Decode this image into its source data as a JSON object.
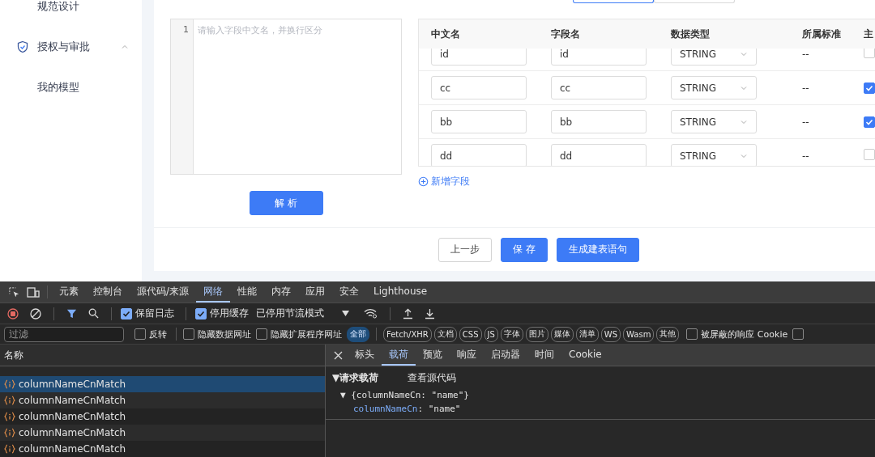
{
  "sidebar": {
    "items": [
      {
        "label": "规范设计",
        "kind": "sub"
      },
      {
        "label": "授权与审批",
        "kind": "group",
        "expanded": true
      },
      {
        "label": "我的模型",
        "kind": "sub"
      }
    ]
  },
  "segments": [
    {
      "selected": true
    },
    {
      "selected": false
    }
  ],
  "editor": {
    "line_number": "1",
    "placeholder": "请输入字段中文名，并换行区分"
  },
  "parse_button": "解 析",
  "table": {
    "columns": [
      "中文名",
      "字段名",
      "数据类型",
      "所属标准",
      "主"
    ],
    "rows": [
      {
        "name_cn": "id",
        "field": "id",
        "type": "STRING",
        "standard": "--",
        "primary": false
      },
      {
        "name_cn": "cc",
        "field": "cc",
        "type": "STRING",
        "standard": "--",
        "primary": true
      },
      {
        "name_cn": "bb",
        "field": "bb",
        "type": "STRING",
        "standard": "--",
        "primary": true
      },
      {
        "name_cn": "dd",
        "field": "dd",
        "type": "STRING",
        "standard": "--",
        "primary": false
      }
    ]
  },
  "add_field": "新增字段",
  "footer_buttons": [
    {
      "label": "上一步",
      "kind": "default"
    },
    {
      "label": "保 存",
      "kind": "primary"
    },
    {
      "label": "生成建表语句",
      "kind": "primary"
    }
  ],
  "devtools": {
    "tabs": [
      {
        "label": "元素",
        "selected": false
      },
      {
        "label": "控制台",
        "selected": false
      },
      {
        "label": "源代码/来源",
        "selected": false
      },
      {
        "label": "网络",
        "selected": true
      },
      {
        "label": "性能",
        "selected": false
      },
      {
        "label": "内存",
        "selected": false
      },
      {
        "label": "应用",
        "selected": false
      },
      {
        "label": "安全",
        "selected": false
      },
      {
        "label": "Lighthouse",
        "selected": false
      }
    ],
    "preserve_log": {
      "label": "保留日志",
      "checked": true
    },
    "disable_cache": {
      "label": "停用缓存",
      "checked": true
    },
    "throttling": "已停用节流模式",
    "filter": {
      "placeholder": "过滤"
    },
    "filter_checks": [
      {
        "label": "反转",
        "checked": false
      },
      {
        "label": "隐藏数据网址",
        "checked": false
      },
      {
        "label": "隐藏扩展程序网址",
        "checked": false
      }
    ],
    "chips": [
      {
        "label": "全部",
        "selected": true
      },
      {
        "label": "Fetch/XHR",
        "selected": false
      },
      {
        "label": "文档",
        "selected": false
      },
      {
        "label": "CSS",
        "selected": false
      },
      {
        "label": "JS",
        "selected": false
      },
      {
        "label": "字体",
        "selected": false
      },
      {
        "label": "图片",
        "selected": false
      },
      {
        "label": "媒体",
        "selected": false
      },
      {
        "label": "清单",
        "selected": false
      },
      {
        "label": "WS",
        "selected": false
      },
      {
        "label": "Wasm",
        "selected": false
      },
      {
        "label": "其他",
        "selected": false
      }
    ],
    "blocked_cookies": {
      "label": "被屏蔽的响应 Cookie",
      "checked": false
    },
    "edge_check": {
      "checked": false
    },
    "list_header": "名称",
    "requests": [
      {
        "name": "columnNameCnMatch",
        "selected": true
      },
      {
        "name": "columnNameCnMatch",
        "selected": false
      },
      {
        "name": "columnNameCnMatch",
        "selected": false
      },
      {
        "name": "columnNameCnMatch",
        "selected": false
      },
      {
        "name": "columnNameCnMatch",
        "selected": false
      }
    ],
    "detail_tabs": [
      {
        "label": "标头",
        "selected": false
      },
      {
        "label": "载荷",
        "selected": true
      },
      {
        "label": "预览",
        "selected": false
      },
      {
        "label": "响应",
        "selected": false
      },
      {
        "label": "启动器",
        "selected": false
      },
      {
        "label": "时间",
        "selected": false
      },
      {
        "label": "Cookie",
        "selected": false
      }
    ],
    "payload": {
      "section": "▼请求载荷",
      "view_source": "查看源代码",
      "object": "▼ {columnNameCn: \"name\"}",
      "key": "columnNameCn",
      "separator": ":",
      "value": "\"name\""
    }
  }
}
